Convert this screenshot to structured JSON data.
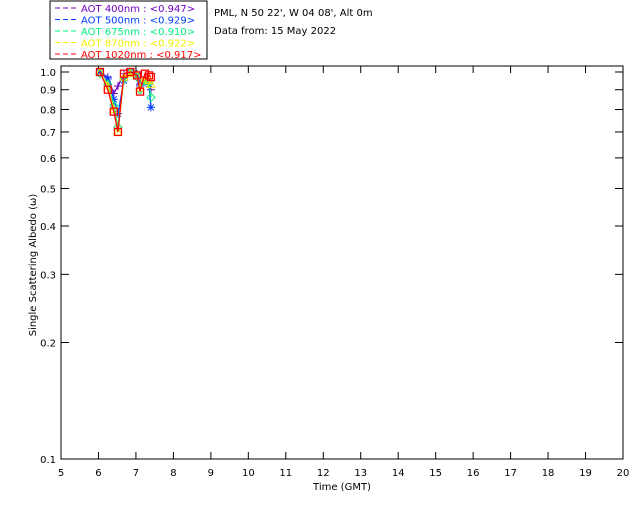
{
  "chart_data": {
    "type": "line",
    "header": {
      "site": "PML, N 50 22', W 04 08', Alt 0m",
      "date": "Data from: 15 May 2022"
    },
    "xlabel": "Time (GMT)",
    "ylabel": "Single Scattering Albedo (ω)",
    "xlim": [
      5,
      20
    ],
    "ylim": [
      0.1,
      1.0
    ],
    "yscale": "log",
    "xticks": [
      "5",
      "6",
      "7",
      "8",
      "9",
      "10",
      "11",
      "12",
      "13",
      "14",
      "15",
      "16",
      "17",
      "18",
      "19",
      "20"
    ],
    "yticks": [
      "0.1",
      "0.2",
      "0.3",
      "0.4",
      "0.5",
      "0.6",
      "0.7",
      "0.8",
      "0.9",
      "1.0"
    ],
    "legend_position": "top-left, outside",
    "x": [
      6.04,
      6.25,
      6.41,
      6.52,
      6.68,
      6.85,
      7.03,
      7.11,
      7.24,
      7.35,
      7.4
    ],
    "series": [
      {
        "name": "AOT  400nm : <0.947>",
        "color": "#7000c0",
        "marker": "plus",
        "values": [
          1.0,
          0.97,
          0.88,
          0.92,
          0.99,
          1.0,
          0.99,
          0.93,
          0.95,
          0.96,
          0.9
        ]
      },
      {
        "name": "AOT  500nm : <0.929>",
        "color": "#0040ff",
        "marker": "asterisk",
        "values": [
          1.0,
          0.96,
          0.85,
          0.78,
          0.95,
          1.0,
          0.98,
          0.92,
          0.94,
          0.93,
          0.81
        ]
      },
      {
        "name": "AOT  675nm : <0.910>",
        "color": "#00f080",
        "marker": "diamond",
        "values": [
          0.99,
          0.93,
          0.82,
          0.72,
          0.96,
          1.0,
          0.97,
          0.9,
          0.95,
          0.94,
          0.86
        ]
      },
      {
        "name": "AOT  870nm : <0.922>",
        "color": "#f0f000",
        "marker": "triangle",
        "values": [
          1.0,
          0.92,
          0.8,
          0.7,
          0.97,
          0.99,
          0.98,
          0.91,
          0.96,
          0.95,
          0.93
        ]
      },
      {
        "name": "AOT 1020nm : <0.917>",
        "color": "#ff0000",
        "marker": "square",
        "values": [
          1.0,
          0.9,
          0.79,
          0.7,
          0.99,
          1.0,
          0.98,
          0.89,
          0.99,
          0.98,
          0.97
        ]
      }
    ]
  }
}
